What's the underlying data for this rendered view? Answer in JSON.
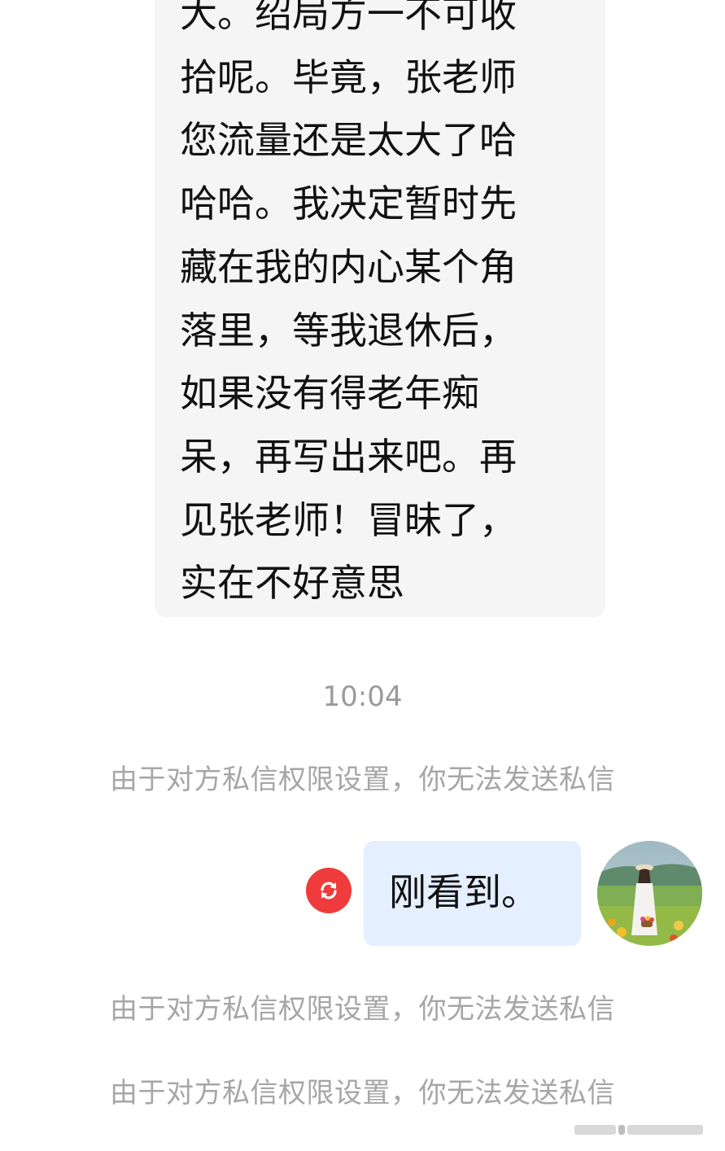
{
  "conversation": {
    "received_message": "大。绍局方一不可收\n拾呢。毕竟，张老师\n您流量还是太大了哈\n哈哈。我决定暂时先\n藏在我的内心某个角\n落里，等我退休后，\n如果没有得老年痴\n呆，再写出来吧。再\n见张老师！冒昧了，\n实在不好意思",
    "timestamp": "10:04",
    "privacy_notice_1": "由于对方私信权限设置，你无法发送私信",
    "sent_message": "刚看到。",
    "privacy_notice_2": "由于对方私信权限设置，你无法发送私信",
    "privacy_notice_3": "由于对方私信权限设置，你无法发送私信"
  },
  "icons": {
    "retry": "retry-icon",
    "avatar": "user-avatar"
  },
  "colors": {
    "received_bubble": "#f5f5f5",
    "sent_bubble": "#e4efff",
    "retry_red": "#ef3b3b",
    "notice_text": "#a6a6a6"
  }
}
